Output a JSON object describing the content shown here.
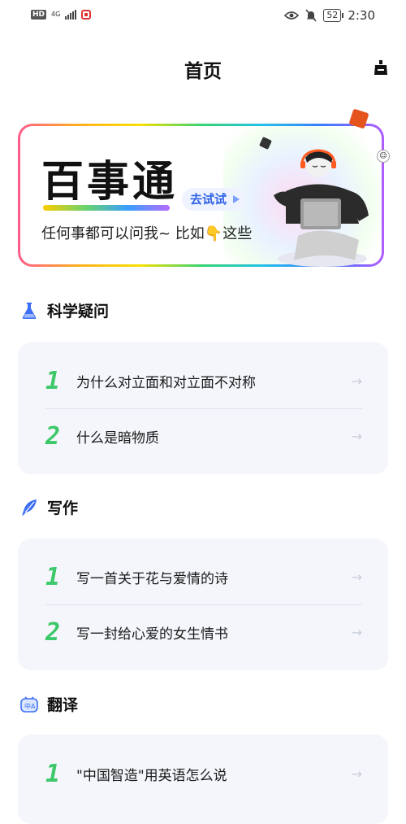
{
  "status_bar": {
    "left_badge": "HD",
    "network": "4G",
    "battery": "52",
    "time": "2:30"
  },
  "header": {
    "title": "首页",
    "right_icon": "broom-icon"
  },
  "banner": {
    "title": "百事通",
    "subtitle": "任何事都可以问我~ 比如👇这些",
    "button_label": "去试试"
  },
  "sections": [
    {
      "title": "科学疑问",
      "icon": "flask-icon",
      "items": [
        {
          "num": "1",
          "text": "为什么对立面和对立面不对称"
        },
        {
          "num": "2",
          "text": "什么是暗物质"
        }
      ]
    },
    {
      "title": "写作",
      "icon": "feather-pen-icon",
      "items": [
        {
          "num": "1",
          "text": "写一首关于花与爱情的诗"
        },
        {
          "num": "2",
          "text": "写一封给心爱的女生情书"
        }
      ]
    },
    {
      "title": "翻译",
      "icon": "translate-icon",
      "items": [
        {
          "num": "1",
          "text": "\"中国智造\"用英语怎么说"
        }
      ]
    }
  ],
  "colors": {
    "accent_blue": "#2f63e6",
    "number_green": "#3ec86a",
    "card_bg": "#f4f6fb"
  }
}
